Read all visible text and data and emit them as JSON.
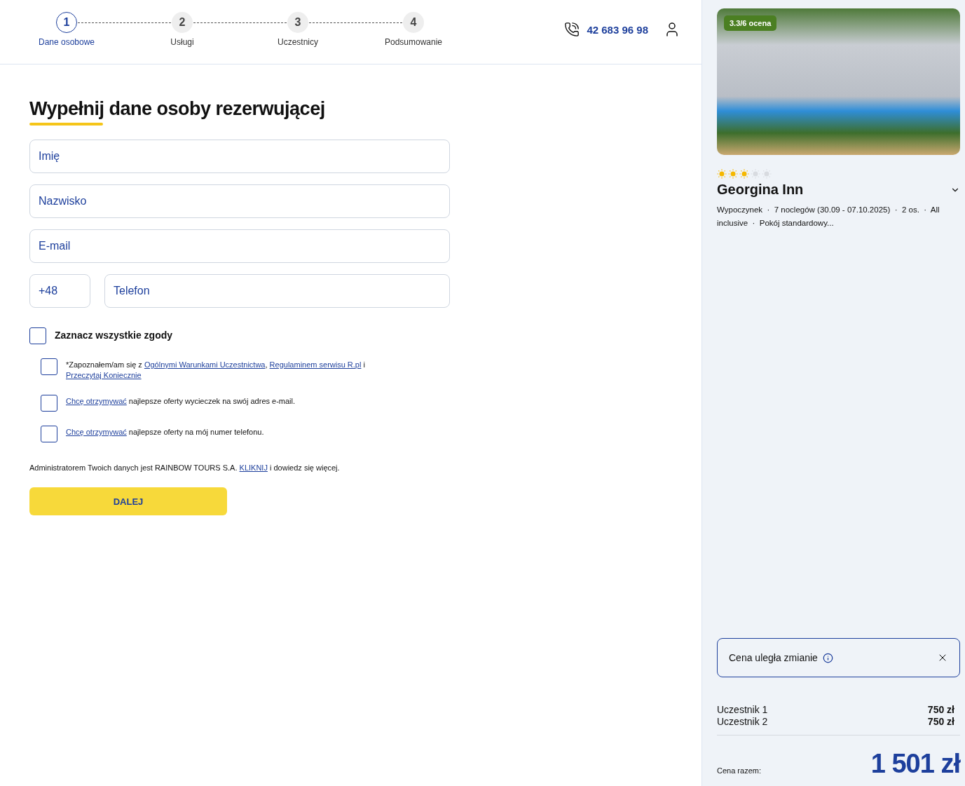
{
  "steps": [
    {
      "number": "1",
      "label": "Dane osobowe",
      "selected": true
    },
    {
      "number": "2",
      "label": "Usługi",
      "selected": false
    },
    {
      "number": "3",
      "label": "Uczestnicy",
      "selected": false
    },
    {
      "number": "4",
      "label": "Podsumowanie",
      "selected": false
    }
  ],
  "phone": "42 683 96 98",
  "heading": "Wypełnij dane osoby rezerwującej",
  "fields": [
    {
      "placeholder": "Imię"
    },
    {
      "placeholder": "Nazwisko"
    },
    {
      "placeholder": "E-mail"
    }
  ],
  "phone_fields": {
    "prefix": "+48",
    "placeholder": "Telefon"
  },
  "select_all": {
    "label": "Zaznacz wszystkie zgody",
    "checked": false
  },
  "consents": [
    {
      "checked": false,
      "parts": [
        {
          "kind": "text",
          "text": "*Zapoznałem/am się z "
        },
        {
          "kind": "link",
          "text": "Ogólnymi Warunkami Uczestnictwa"
        },
        {
          "kind": "text",
          "text": ", "
        },
        {
          "kind": "link",
          "text": "Regulaminem serwisu R.pl"
        },
        {
          "kind": "text",
          "text": " i "
        },
        {
          "kind": "link",
          "text": "Przeczytaj Koniecznie"
        }
      ]
    },
    {
      "checked": false,
      "parts": [
        {
          "kind": "link",
          "text": "Chcę otrzymywać"
        },
        {
          "kind": "text",
          "text": " najlepsze oferty wycieczek na swój adres e-mail."
        }
      ]
    },
    {
      "checked": false,
      "parts": [
        {
          "kind": "link",
          "text": "Chcę otrzymywać"
        },
        {
          "kind": "text",
          "text": " najlepsze oferty na mój numer telefonu."
        }
      ]
    }
  ],
  "admin_note": [
    {
      "kind": "text",
      "text": "Administratorem Twoich danych jest RAINBOW TOURS S.A. "
    },
    {
      "kind": "link",
      "text": "KLIKNIJ"
    },
    {
      "kind": "text",
      "text": " i dowiedz się więcej."
    }
  ],
  "next_button": "DALEJ",
  "hotel": {
    "rating_badge": "3.3/6 ocena",
    "stars": 3,
    "name": "Georgina Inn",
    "details": "Wypoczynek  ·  7 noclegów (30.09 - 07.10.2025)  ·  2 os.  ·  All inclusive  ·  Pokój standardowy..."
  },
  "notice": "Cena uległa zmianie",
  "participants": [
    {
      "name": "Uczestnik 1",
      "price": "750 zł"
    },
    {
      "name": "Uczestnik 2",
      "price": "750 zł"
    }
  ],
  "total": {
    "label": "Cena razem:",
    "value": "1 501 zł"
  }
}
